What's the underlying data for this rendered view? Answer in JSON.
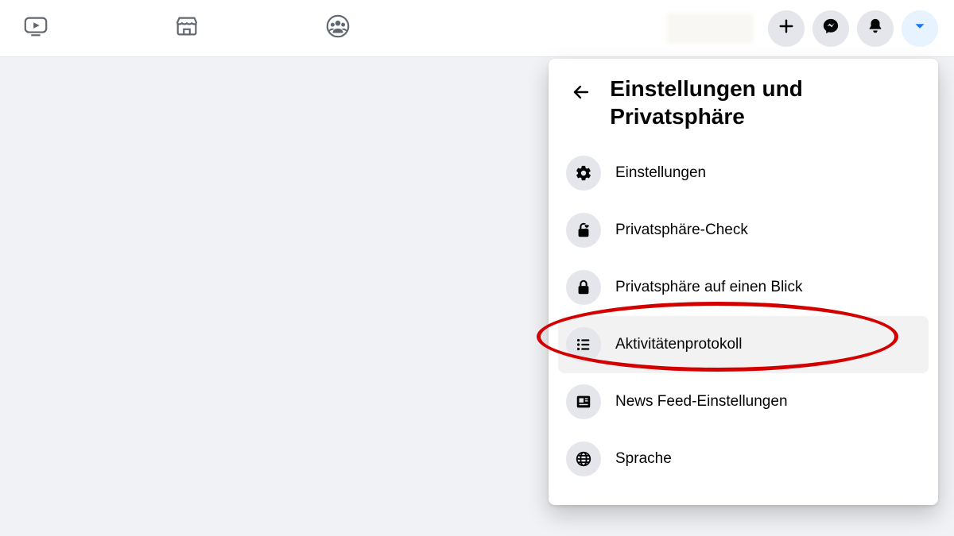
{
  "panel": {
    "title": "Einstellungen und Privatsphäre"
  },
  "menu": {
    "items": [
      {
        "label": "Einstellungen",
        "icon": "gear-icon"
      },
      {
        "label": "Privatsphäre-Check",
        "icon": "lock-heart-icon"
      },
      {
        "label": "Privatsphäre auf einen Blick",
        "icon": "lock-icon"
      },
      {
        "label": "Aktivitätenprotokoll",
        "icon": "list-icon",
        "highlighted": true
      },
      {
        "label": "News Feed-Einstellungen",
        "icon": "newsfeed-icon"
      },
      {
        "label": "Sprache",
        "icon": "globe-icon"
      }
    ]
  },
  "annotation": {
    "color": "#d40000"
  }
}
